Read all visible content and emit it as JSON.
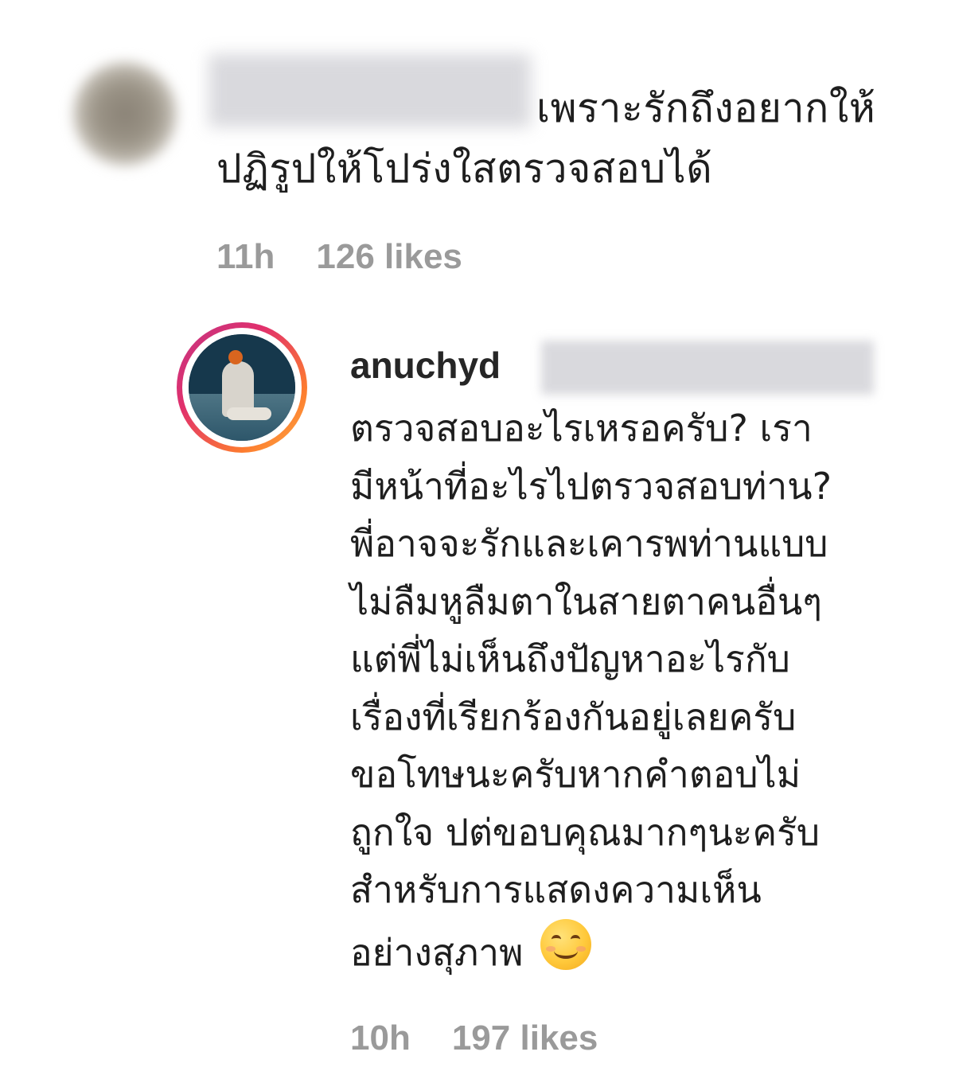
{
  "comment": {
    "text_line_1": "เพราะรักถึงอยากให้",
    "text_line_2": "ปฏิรูปให้โปร่งใสตรวจสอบได้",
    "time": "11h",
    "likes": "126 likes"
  },
  "reply": {
    "username": "anuchyd",
    "lines": [
      "ตรวจสอบอะไรเหรอครับ? เรา",
      "มีหน้าที่อะไรไปตรวจสอบท่าน?",
      "พี่อาจจะรักและเคารพท่านแบบ",
      "ไม่ลืมหูลืมตาในสายตาคนอื่นๆ",
      "แต่พี่ไม่เห็นถึงปัญหาอะไรกับ",
      "เรื่องที่เรียกร้องกันอยู่เลยครับ",
      "ขอโทษนะครับหากคำตอบไม่",
      "ถูกใจ ปต่ขอบคุณมากๆนะครับ",
      "สำหรับการแสดงความเห็น",
      "อย่างสุภาพ"
    ],
    "emoji": "smiling-face-with-smiling-eyes",
    "time": "10h",
    "likes": "197 likes"
  },
  "colors": {
    "text": "#262626",
    "meta": "#9a9a9a",
    "story_ring": "#e1306c"
  }
}
